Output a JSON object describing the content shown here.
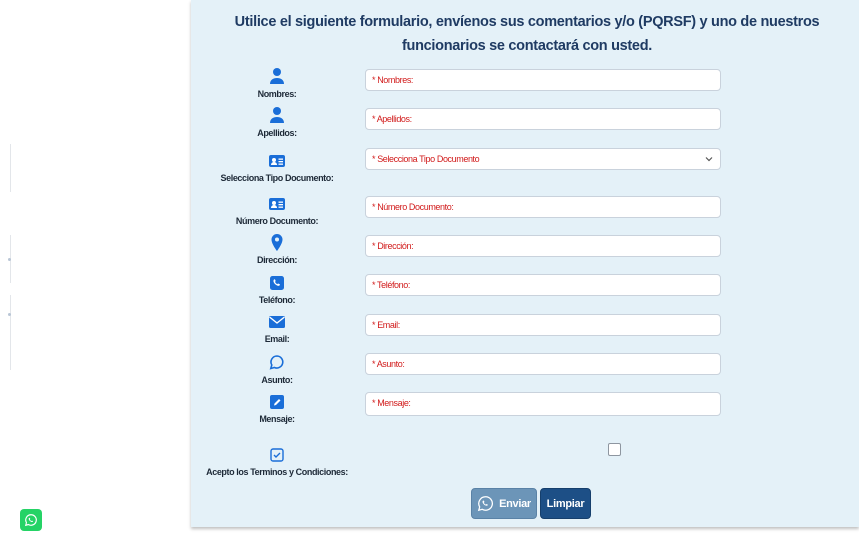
{
  "form": {
    "heading": "Utilice el siguiente formulario, envíenos sus comentarios y/o (PQRSF) y uno de nuestros funcionarios se contactará con usted.",
    "fields": [
      {
        "label": "Nombres:",
        "placeholder": "* Nombres:",
        "icon": "user-icon"
      },
      {
        "label": "Apellidos:",
        "placeholder": "* Apellidos:",
        "icon": "user-icon"
      },
      {
        "label": "Selecciona Tipo Documento:",
        "placeholder": "* Selecciona Tipo Documento",
        "icon": "id-card-icon"
      },
      {
        "label": "Número Documento:",
        "placeholder": "* Número Documento:",
        "icon": "id-card-icon"
      },
      {
        "label": "Dirección:",
        "placeholder": "* Dirección:",
        "icon": "map-pin-icon"
      },
      {
        "label": "Teléfono:",
        "placeholder": "* Teléfono:",
        "icon": "phone-icon"
      },
      {
        "label": "Email:",
        "placeholder": "* Email:",
        "icon": "envelope-icon"
      },
      {
        "label": "Asunto:",
        "placeholder": "* Asunto:",
        "icon": "chat-bubble-icon"
      },
      {
        "label": "Mensaje:",
        "placeholder": "* Mensaje:",
        "icon": "pencil-icon"
      }
    ],
    "terms": {
      "label": "Acepto los Terminos y Condiciones:",
      "icon": "checkbox-icon",
      "checked": false
    },
    "buttons": {
      "send": "Enviar",
      "clear": "Limpiar",
      "send_icon": "whatsapp-icon"
    }
  },
  "floating": {
    "icon": "whatsapp-icon"
  },
  "colors": {
    "panel_bg": "#e4f1f8",
    "heading": "#1f3b63",
    "icon_blue": "#1a6ed8",
    "required_red": "#d11a1a",
    "send_button": "#6c95b8",
    "clear_button": "#1d4f86",
    "whatsapp_green": "#25d366"
  }
}
